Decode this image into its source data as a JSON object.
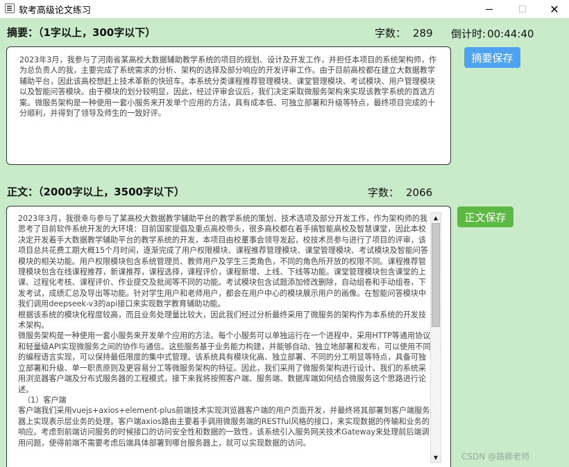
{
  "window": {
    "title": "软考高级论文练习",
    "minimize": "—",
    "maximize": "□",
    "close": "✕"
  },
  "abstract": {
    "label": "摘要：（1字以上，300字以下）",
    "count_label": "字数：",
    "count": "289",
    "save_label": "摘要保存",
    "text": "2023年3月，我参与了河南省某高校大数据辅助教学系统的项目的规划、设计及开发工作，并担任本项目的系统架构师，作为总负责人的我，主要完成了系统需求的分析、架构的选择及部分响应的开发评审工作。由于目前高校都在建立大数据教学辅助平台，因此该高校想赶上技术革新的快班车。本系统分类课程推荐管理模块、课堂管理模块、考试模块、用户管理模块以及智能问答模块。由于模块的划分较明显，因此，经过评审会议后，我们决定采取微服务架构来实现该教学系统的首选方案。微服务架构是一种使用一套小服务来开发单个应用的方法，具有成本低、可独立部署和升级等特点，最终项目完成的十分顺利，并得到了领导及师生的一致好评。"
  },
  "timer": {
    "label": "倒计时:",
    "value": "00:44:40"
  },
  "body": {
    "label": "正文：（2000字以上，3500字以下）",
    "count_label": "字数：",
    "count": "2066",
    "save_label": "正文保存",
    "text": "2023年3月，我很幸与参与了某高校大数据教学辅助平台的教学系统的策划、技术选项及部分开发工作，作为架构师的我思考了目前软件系统开发的大环境：目前国家提倡及重点高校带头，很多高校都在着手搞智能高校及智慧课堂，因此本校决定开发着手大数据教学辅助平台的教学系统的开发，本项目由校董事会领导发起，校技术员参与进行了项目的评审，该项目总共花费工期大概15个月时间，逐渐完成了用户权限模块、课程推荐管理模块、课堂管理模块、考试模块及智能问答模块的相关功能。用户权限模块包含系统管理员、教师用户及学生三类角色，不同的角色所开放的权限不同。课程推荐管理模块包含在线课程推荐，新课推荐，课程选择，课程评价，课程新增、上线、下线等功能。课堂管理模块包含课堂的上课、过程化考核、课程评价、作业提交及批阅等不同的功能。考试模块包含试题添加修改删除，自动组卷和手动组卷，下发考试，成绩汇总及导出等功能。针对学生用户和老师用户，都会在用户中心的模块展示用户的画像。在智能问答模块中我们调用deepseek-v3的api接口来实现数学教育辅助功能。\n根据该系统的模块化程度较高，而且业务处理量比较大，因此我们经过分析最终采用了微服务的架构作为本系统的开发技术架构。\n微服务架构是一种使用一套小服务来开发单个应用的方法。每个小服务可以单独运行在一个进程中，采用HTTP等通用协议和轻量级API实现微服务之间的协作与通信。这些服务基于业务能力构建，并能够自动、独立地部署和发布，可以使用不同的编程语言实现，可以保持最低限度的集中式管理。该系统具有模块化高、独立部署、不同的分工明显等特点，具备可独立部署和升级、单一职责原则及更容易分工等微服务架构的特征。因此，我们采用了微服务架构进行设计。我们的系统采用浏览器客户端及分布式服务器的工程模式，接下来我将按照客户端、服务端、数据库端如何结合微服务这个思路进行论述。\n  （1）客户端\n客户端我们采用vuejs+axios+element-plus前端技术实现浏览器客户端的用户页面开发，并最终将其部署到客户端服务器上实现表示层业务的处理。客户端axios路由主要着手调用微服务端的RESTful风格的接口，来实现数据的传输和业务的响应。考虑到前端访问服务的时候接口的访问安全性和数据的一致性，该系统引入服务网关技术Gateway来处理前后端调用问题，使得前端不需要考虑后端具体部署到哪台服务器上，就可以实现数据的访问。"
  },
  "watermark": "CSDN @路卿老师",
  "colors": {
    "background": "#c9ebc9",
    "abstract_button": "#4ea3f0",
    "body_button": "#5cba44"
  }
}
